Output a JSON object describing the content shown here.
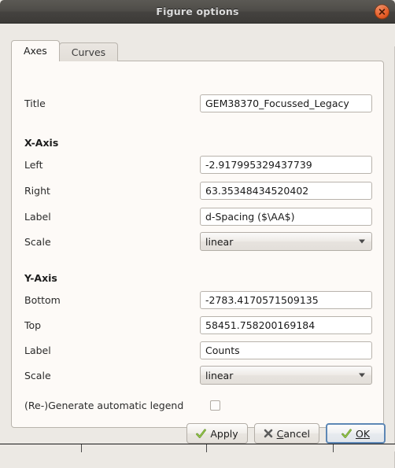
{
  "window": {
    "title": "Figure options",
    "close_icon": "close-icon"
  },
  "tabs": [
    {
      "label": "Axes",
      "active": true
    },
    {
      "label": "Curves",
      "active": false
    }
  ],
  "form": {
    "title_label": "Title",
    "title_value": "GEM38370_Focussed_Legacy",
    "x_axis": {
      "section": "X-Axis",
      "left_label": "Left",
      "left_value": "-2.917995329437739",
      "right_label": "Right",
      "right_value": "63.35348434520402",
      "label_label": "Label",
      "label_value": "d-Spacing ($\\AA$)",
      "scale_label": "Scale",
      "scale_value": "linear"
    },
    "y_axis": {
      "section": "Y-Axis",
      "bottom_label": "Bottom",
      "bottom_value": "-2783.4170571509135",
      "top_label": "Top",
      "top_value": "58451.758200169184",
      "label_label": "Label",
      "label_value": "Counts",
      "scale_label": "Scale",
      "scale_value": "linear"
    },
    "legend": {
      "label": "(Re-)Generate automatic legend",
      "checked": false
    }
  },
  "buttons": {
    "apply": "Apply",
    "cancel_underlined": "C",
    "cancel_rest": "ancel",
    "ok_underlined": "O",
    "ok_rest": "K"
  },
  "colors": {
    "accent_close": "#e8612c",
    "focus_border": "#5d87b5",
    "check_green": "#7bb03b",
    "dialog_bg": "#ece9e4",
    "panel_bg": "#fdfaf7"
  }
}
